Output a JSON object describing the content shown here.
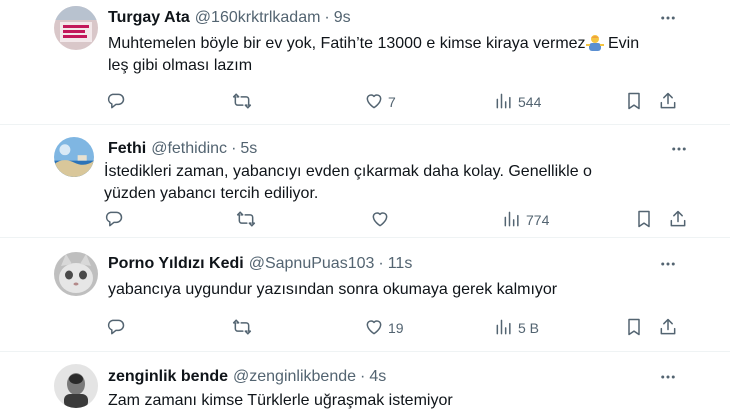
{
  "tweets": [
    {
      "name": "Turgay Ata",
      "handle": "@160krktrlkadam",
      "separator": "·",
      "time": "9s",
      "text_before_emoji": "Muhtemelen böyle bir ev yok, Fatih’te 13000 e kimse kiraya vermez",
      "text_after_emoji": " Evin\nleş gibi olması lazım",
      "emoji": "man-shrugging-emoji",
      "likes": "7",
      "views": "544"
    },
    {
      "name": "Fethi",
      "handle": "@fethidinc",
      "separator": "·",
      "time": "5s",
      "text": "İstedikleri zaman, yabancıyı evden çıkarmak daha kolay. Genellikle o\nyüzden yabancı tercih ediliyor.",
      "likes": "",
      "views": "774"
    },
    {
      "name": "Porno Yıldızı Kedi",
      "handle": "@SapnuPuas103",
      "separator": "·",
      "time": "11s",
      "text": "yabancıya uygundur yazısından sonra okumaya gerek kalmıyor",
      "likes": "19",
      "views": "5 B"
    },
    {
      "name": "zenginlik bende",
      "handle": "@zenginlikbende",
      "separator": "·",
      "time": "4s",
      "text": "Zam zamanı kimse Türklerle uğraşmak istemiyor"
    }
  ],
  "colors": {
    "text": "#0f1419",
    "secondary": "#536471",
    "divider": "#eff3f4"
  },
  "icons": [
    "reply-icon",
    "retweet-icon",
    "like-icon",
    "views-icon",
    "bookmark-icon",
    "share-icon",
    "more-icon"
  ]
}
